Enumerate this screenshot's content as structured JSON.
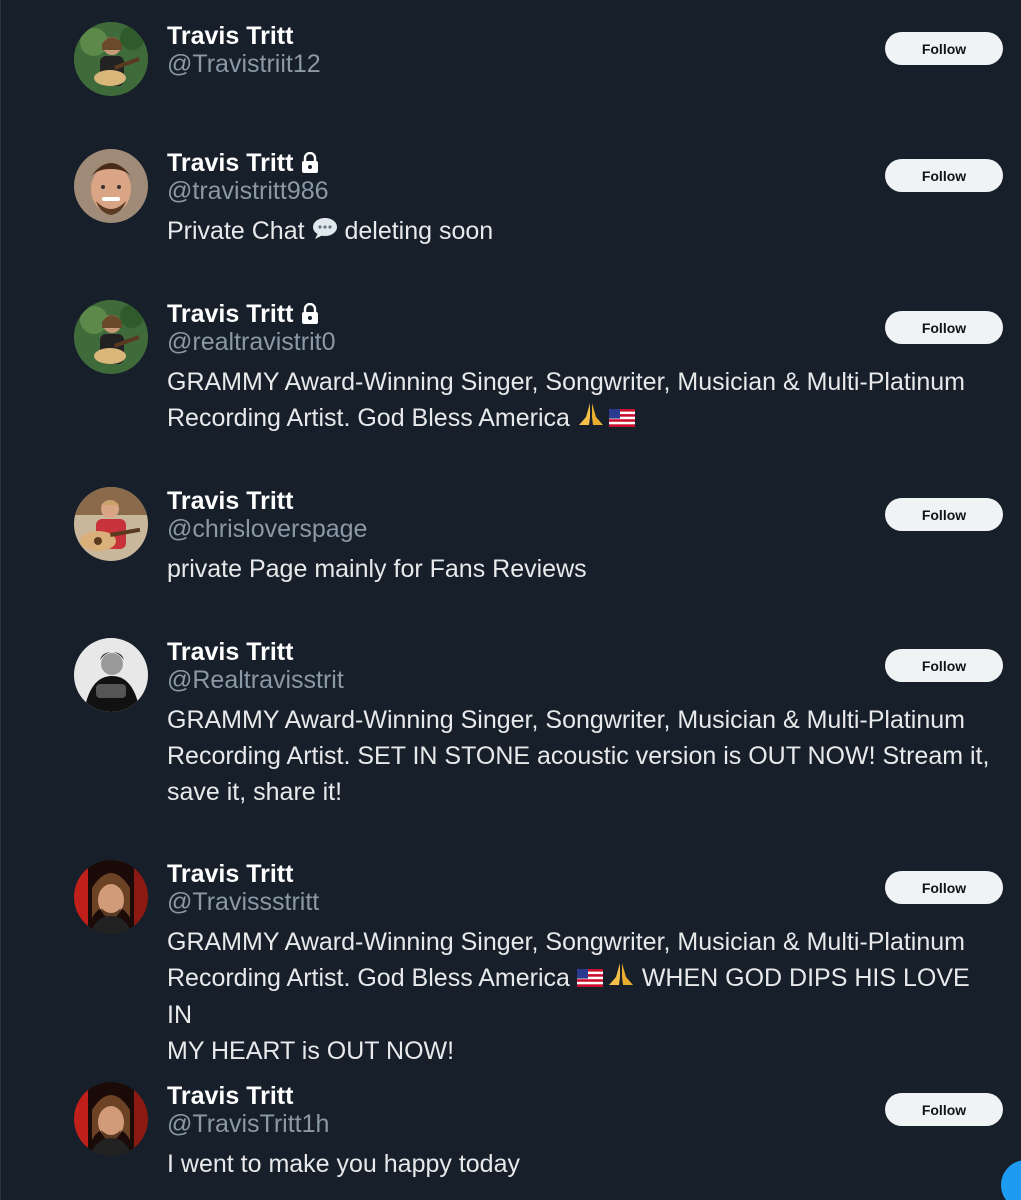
{
  "follow_label": "Follow",
  "users": [
    {
      "name": "Travis Tritt",
      "handle": "@Travistriit12",
      "locked": false,
      "bio": "",
      "avatar": "man-with-guitar-outdoors"
    },
    {
      "name": "Travis Tritt",
      "handle": "@travistritt986",
      "locked": true,
      "bio_before": "Private Chat ",
      "bio_emoji": "speech-bubble-icon",
      "bio_after": " deleting soon",
      "avatar": "man-portrait-closeup"
    },
    {
      "name": "Travis Tritt",
      "handle": "@realtravistrit0",
      "locked": true,
      "bio_line1": "GRAMMY Award-Winning Singer, Songwriter, Musician & Multi-Platinum",
      "bio_line2": "Recording Artist. God Bless America ",
      "bio_emojis": [
        "praying-hands-icon",
        "us-flag-icon"
      ],
      "avatar": "man-with-guitar-outdoors"
    },
    {
      "name": "Travis Tritt",
      "handle": "@chrisloverspage",
      "locked": false,
      "bio": "private Page mainly for Fans Reviews",
      "avatar": "man-red-shirt-guitar"
    },
    {
      "name": "Travis Tritt",
      "handle": "@Realtravisstrit",
      "locked": false,
      "bio_line1": "GRAMMY Award-Winning Singer, Songwriter, Musician & Multi-Platinum",
      "bio_line2": "Recording Artist. SET IN STONE acoustic version is OUT NOW! Stream it,",
      "bio_line3": "save it, share it!",
      "avatar": "man-black-white-portrait"
    },
    {
      "name": "Travis Tritt",
      "handle": "@Travissstritt",
      "locked": false,
      "bio_line1": "GRAMMY Award-Winning Singer, Songwriter, Musician & Multi-Platinum",
      "bio_line2_before": "Recording Artist. God Bless America ",
      "bio_line2_after": " WHEN GOD DIPS HIS LOVE IN",
      "bio_emojis": [
        "us-flag-icon",
        "praying-hands-icon"
      ],
      "bio_line3": "MY HEART is OUT NOW!",
      "avatar": "man-long-hair-red-backdrop"
    },
    {
      "name": "Travis Tritt",
      "handle": "@TravisTritt1h",
      "locked": false,
      "bio": "I went to make you happy today",
      "avatar": "man-long-hair-red-backdrop"
    }
  ],
  "colors": {
    "background": "#161f2a",
    "name": "#ffffff",
    "handle": "#8b98a5",
    "bio": "#e7e9ea",
    "button_bg": "#eff3f4",
    "button_text": "#0f1419",
    "accent": "#1d9bf0"
  }
}
